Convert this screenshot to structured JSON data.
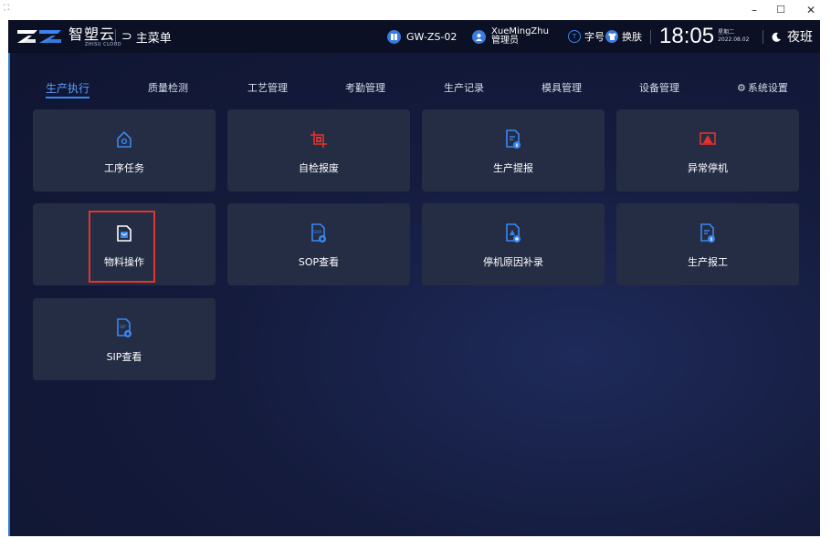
{
  "window": {
    "app_icon": "app-icon",
    "controls": {
      "minimize": "–",
      "maximize": "☐",
      "close": "✕"
    }
  },
  "header": {
    "brand_name": "智塑云",
    "brand_sub": "ZHISU CLOUD",
    "main_menu": "主菜单",
    "device": "GW-ZS-02",
    "user": {
      "name": "XueMingZhu",
      "role": "管理员"
    },
    "font_size_label": "字号",
    "skin_label": "换肤",
    "time": "18:05",
    "weekday": "星期二",
    "date": "2022.08.02",
    "shift": "夜班"
  },
  "tabs": [
    {
      "label": "生产执行",
      "active": true
    },
    {
      "label": "质量检测"
    },
    {
      "label": "工艺管理"
    },
    {
      "label": "考勤管理"
    },
    {
      "label": "生产记录"
    },
    {
      "label": "模具管理"
    },
    {
      "label": "设备管理"
    },
    {
      "label": "系统设置",
      "icon": "gear-icon"
    }
  ],
  "tiles": [
    {
      "label": "工序任务",
      "icon": "house-gear-icon"
    },
    {
      "label": "自检报废",
      "icon": "crop-scrap-icon"
    },
    {
      "label": "生产提报",
      "icon": "document-info-icon"
    },
    {
      "label": "异常停机",
      "icon": "warning-monitor-icon"
    },
    {
      "label": "物料操作",
      "icon": "material-box-icon",
      "selected": true
    },
    {
      "label": "SOP查看",
      "icon": "sop-document-icon"
    },
    {
      "label": "停机原因补录",
      "icon": "document-add-icon"
    },
    {
      "label": "生产报工",
      "icon": "document-info-icon"
    },
    {
      "label": "SIP查看",
      "icon": "sip-document-icon"
    }
  ],
  "colors": {
    "accent": "#3a86f0",
    "tile_bg": "#252d44",
    "alert": "#e0342c",
    "background": "#141b3c"
  }
}
